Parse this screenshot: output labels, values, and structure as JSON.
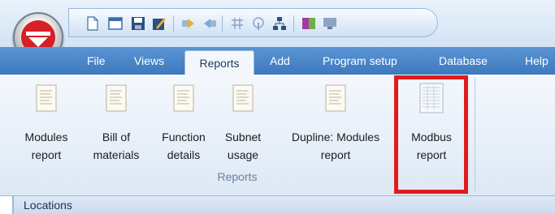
{
  "window": {
    "qat_icons": [
      "new-doc-icon",
      "open-icon",
      "save-icon",
      "edit-icon",
      "forward-icon",
      "back-icon",
      "grid-icon",
      "signal-icon",
      "network-icon",
      "colors-icon",
      "monitor-icon"
    ]
  },
  "tabs": [
    "File",
    "Views",
    "Reports",
    "Add",
    "Program setup",
    "Database",
    "Help"
  ],
  "active_tab": "Reports",
  "ribbon": {
    "group_label": "Reports",
    "buttons": [
      {
        "line1": "Modules",
        "line2": "report"
      },
      {
        "line1": "Bill of",
        "line2": "materials"
      },
      {
        "line1": "Function",
        "line2": "details"
      },
      {
        "line1": "Subnet",
        "line2": "usage"
      },
      {
        "line1": "Dupline: Modules",
        "line2": "report"
      },
      {
        "line1": "Modbus",
        "line2": "report"
      }
    ]
  },
  "locations": {
    "label": "Locations"
  },
  "colors": {
    "tab_bar": "#3d79be",
    "highlight": "#e01b1b",
    "orb": "#d91f26"
  }
}
